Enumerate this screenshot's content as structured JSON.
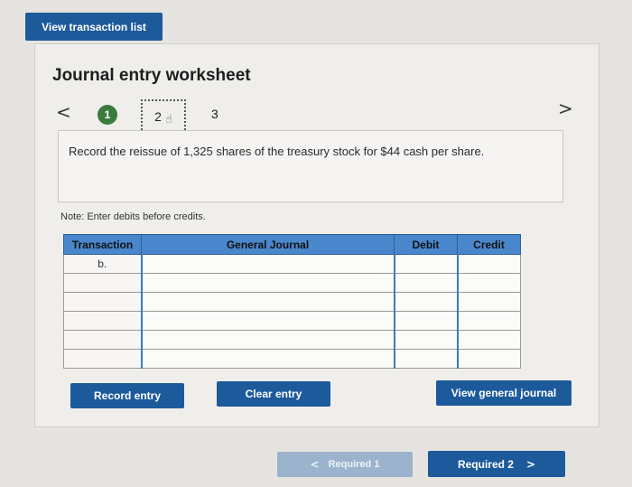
{
  "top_button": "View transaction list",
  "worksheet": {
    "title": "Journal entry worksheet",
    "prev_arrow": "<",
    "next_arrow": ">",
    "steps": [
      "1",
      "2",
      "3"
    ],
    "instruction": "Record the reissue of 1,325 shares of the treasury stock for $44 cash per share.",
    "note": "Note: Enter debits before credits."
  },
  "journal": {
    "headers": [
      "Transaction",
      "General Journal",
      "Debit",
      "Credit"
    ],
    "rows": [
      [
        "b.",
        "",
        "",
        ""
      ],
      [
        "",
        "",
        "",
        ""
      ],
      [
        "",
        "",
        "",
        ""
      ],
      [
        "",
        "",
        "",
        ""
      ],
      [
        "",
        "",
        "",
        ""
      ],
      [
        "",
        "",
        "",
        ""
      ]
    ]
  },
  "buttons": {
    "record_entry": "Record entry",
    "clear_entry": "Clear entry",
    "view_general_journal": "View general journal"
  },
  "pager": {
    "prev_label": "Required 1",
    "prev_chevron": "<",
    "next_label": "Required 2",
    "next_chevron": ">"
  },
  "colors": {
    "primary_button": "#1d5a9c",
    "table_header": "#4a86cc",
    "step_complete": "#3b7a3d",
    "disabled_button": "#9bb3cd"
  }
}
